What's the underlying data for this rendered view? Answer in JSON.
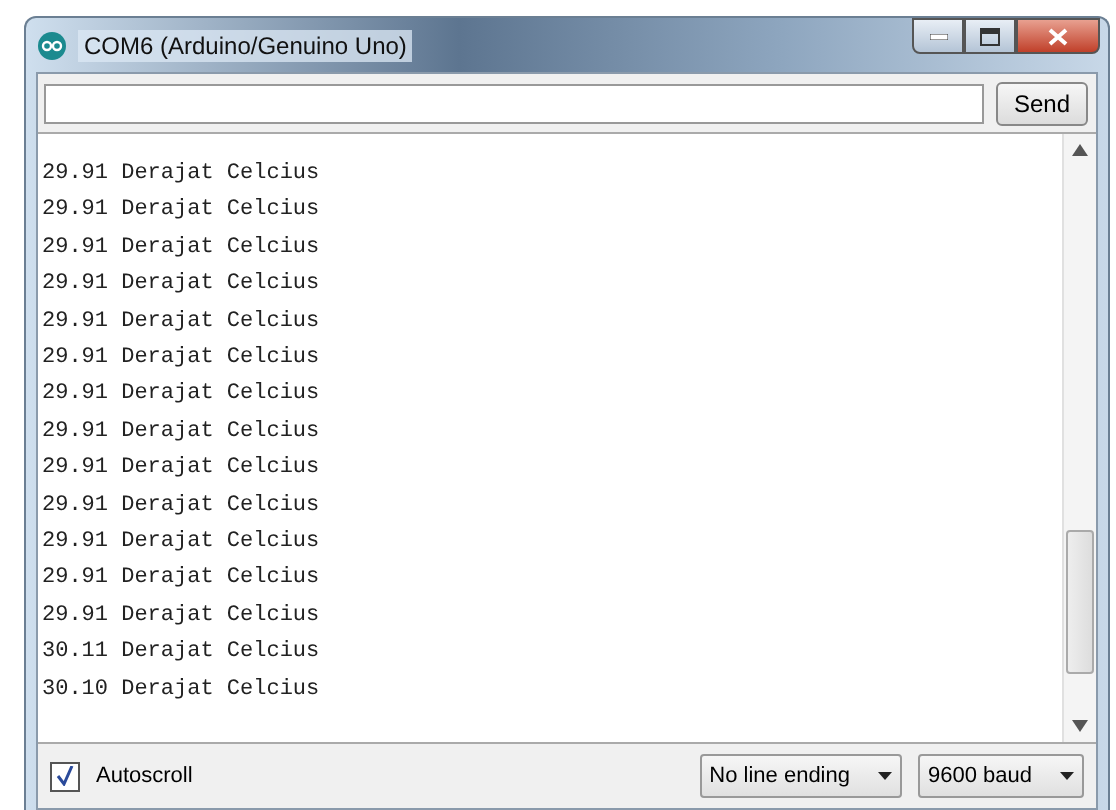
{
  "window": {
    "title": "COM6 (Arduino/Genuino Uno)"
  },
  "send_button": "Send",
  "output_lines": [
    "29.91 Derajat Celcius",
    "29.91 Derajat Celcius",
    "29.91 Derajat Celcius",
    "29.91 Derajat Celcius",
    "29.91 Derajat Celcius",
    "29.91 Derajat Celcius",
    "29.91 Derajat Celcius",
    "29.91 Derajat Celcius",
    "29.91 Derajat Celcius",
    "29.91 Derajat Celcius",
    "29.91 Derajat Celcius",
    "29.91 Derajat Celcius",
    "29.91 Derajat Celcius",
    "30.11 Derajat Celcius",
    "30.10 Derajat Celcius"
  ],
  "autoscroll": {
    "label": "Autoscroll",
    "checked": true
  },
  "line_ending": "No line ending",
  "baud": "9600 baud"
}
